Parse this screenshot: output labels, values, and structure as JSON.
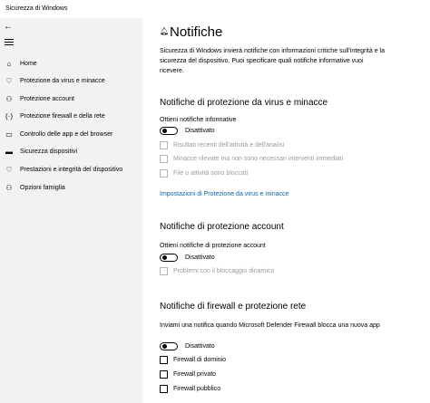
{
  "window": {
    "title": "Sicurezza di Windows"
  },
  "sidebar": {
    "items": [
      {
        "label": "Home",
        "icon": "home-icon"
      },
      {
        "label": "Protezione da virus e minacce",
        "icon": "shield-icon"
      },
      {
        "label": "Protezione account",
        "icon": "person-icon"
      },
      {
        "label": "Protezione firewall e della rete",
        "icon": "wifi-icon"
      },
      {
        "label": "Controllo delle app e del browser",
        "icon": "browser-icon"
      },
      {
        "label": "Sicurezza dispositivi",
        "icon": "laptop-icon"
      },
      {
        "label": "Prestazioni e integrità del dispositivo",
        "icon": "heart-icon"
      },
      {
        "label": "Opzioni famiglia",
        "icon": "family-icon"
      }
    ]
  },
  "main": {
    "title": "Notifiche",
    "description": "Sicurezza di Windows invierà notifiche con informazioni critiche sull'integrità e la sicurezza del dispositivo. Puoi specificare quali notifiche informative vuoi ricevere.",
    "virus": {
      "title": "Notifiche di protezione da virus e minacce",
      "subtitle": "Ottieni notifiche informative",
      "toggle_state": "Disattivato",
      "options": [
        "Risultati recenti dell'attività e dell'analisi",
        "Minacce rilevate ma non sono necessari interventi immediati",
        "File o attività sono bloccati"
      ],
      "link": "Impostazioni di Protezione da virus e minacce"
    },
    "account": {
      "title": "Notifiche di protezione account",
      "subtitle": "Ottieni notifiche di protezione account",
      "toggle_state": "Disattivato",
      "options": [
        "Problemi con il bloccaggio dinamico"
      ]
    },
    "firewall": {
      "title": "Notifiche di firewall e protezione rete",
      "subtitle": "Inviami una notifica quando Microsoft Defender Firewall blocca una nuova app",
      "toggle_state": "Disattivato",
      "options": [
        "Firewall di dominio",
        "Firewall privato",
        "Firewall pubblico"
      ]
    }
  },
  "colors": {
    "link": "#0067b8",
    "sidebar_bg": "#f2f2f2",
    "disabled_text": "#9a9a9a"
  }
}
